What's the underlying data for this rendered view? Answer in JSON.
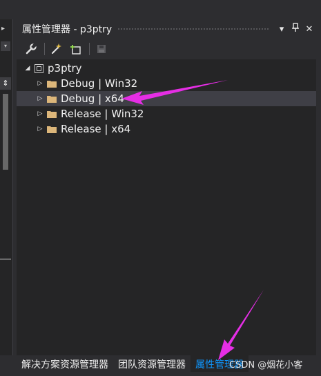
{
  "window": {
    "title": "属性管理器 - p3ptry",
    "dropdown_glyph": "▾",
    "pin_glyph": "⊥",
    "close_glyph": "✕"
  },
  "left_strip": {
    "arrow_glyph": "▸",
    "scroll_glyph": "▾",
    "splitter_glyph": "⇕"
  },
  "toolbar": {
    "buttons": [
      {
        "icon": "wrench-icon",
        "label": "properties"
      },
      {
        "icon": "wand-icon",
        "label": "add new property sheet"
      },
      {
        "icon": "add-existing-sheet-icon",
        "label": "add existing property sheet"
      },
      {
        "icon": "save-icon",
        "label": "save"
      }
    ]
  },
  "tree": {
    "root": {
      "label": "p3ptry",
      "expander": "◢"
    },
    "expander_collapsed": "▷",
    "items": [
      {
        "label": "Debug | Win32",
        "selected": false
      },
      {
        "label": "Debug | x64",
        "selected": true
      },
      {
        "label": "Release | Win32",
        "selected": false
      },
      {
        "label": "Release | x64",
        "selected": false
      }
    ]
  },
  "tabs": [
    {
      "label": "解决方案资源管理器",
      "active": false
    },
    {
      "label": "团队资源管理器",
      "active": false
    },
    {
      "label": "属性管理器",
      "active": true
    }
  ],
  "watermark": "CSDN @烟花小客",
  "colors": {
    "background": "#2d2d30",
    "panel": "#252526",
    "selected_row": "#3f3f46",
    "active_tab_text": "#0e97ff",
    "folder": "#dcb67a",
    "annotation": "#e52ee5"
  }
}
